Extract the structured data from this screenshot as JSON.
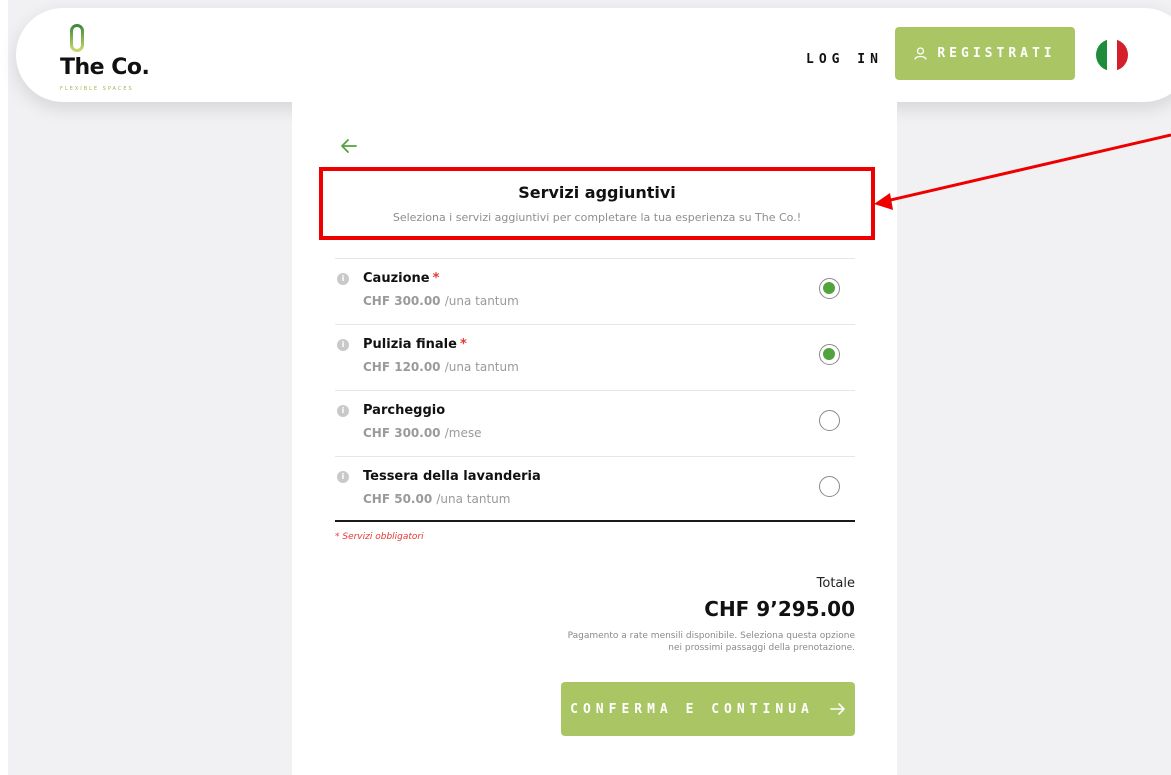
{
  "header": {
    "logo_text": "The Co.",
    "logo_subtext": "FLEXIBLE SPACES",
    "login_label": "LOG IN",
    "register_label": "REGISTRATI",
    "language": "italian-flag-icon"
  },
  "main": {
    "back_icon": "arrow-left-icon",
    "title": "Servizi aggiuntivi",
    "subtitle": "Seleziona i servizi aggiuntivi per completare la tua esperienza su The Co.!",
    "services": [
      {
        "name": "Cauzione",
        "required": true,
        "price": "CHF 300.00",
        "unit": "/una tantum",
        "selected": true
      },
      {
        "name": "Pulizia finale",
        "required": true,
        "price": "CHF 120.00",
        "unit": "/una tantum",
        "selected": true
      },
      {
        "name": "Parcheggio",
        "required": false,
        "price": "CHF 300.00",
        "unit": "/mese",
        "selected": false
      },
      {
        "name": "Tessera della lavanderia",
        "required": false,
        "price": "CHF 50.00",
        "unit": "/una tantum",
        "selected": false
      }
    ],
    "required_star": "*",
    "required_note": "* Servizi obbligatori",
    "total_label": "Totale",
    "total_value": "CHF 9’295.00",
    "payment_note_line1": "Pagamento a rate mensili disponibile. Seleziona questa opzione",
    "payment_note_line2": "nei prossimi passaggi della prenotazione.",
    "confirm_label": "CONFERMA E CONTINUA"
  },
  "colors": {
    "accent": "#a9c564",
    "radio_selected": "#52a33e",
    "required": "#e53935",
    "annotation": "#ee0000"
  }
}
